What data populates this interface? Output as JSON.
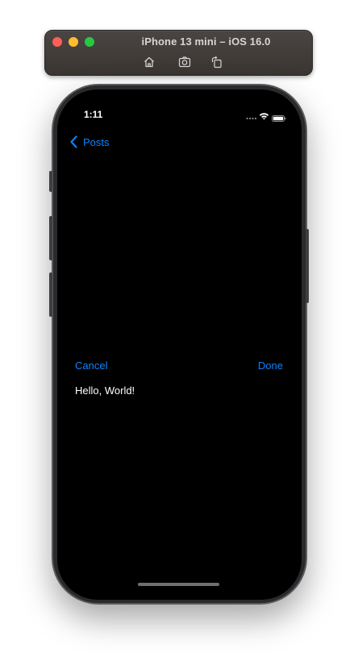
{
  "simulator": {
    "title": "iPhone 13 mini – iOS 16.0",
    "toolbar": [
      {
        "icon": "home-icon"
      },
      {
        "icon": "screenshot-icon"
      },
      {
        "icon": "rotate-icon"
      }
    ]
  },
  "status_bar": {
    "time": "1:11",
    "icons": [
      "signal-dots-icon",
      "wifi-icon",
      "battery-icon"
    ]
  },
  "nav": {
    "back_label": "Posts",
    "back_icon": "chevron-left-icon"
  },
  "editor": {
    "cancel_label": "Cancel",
    "done_label": "Done",
    "text": "Hello, World!"
  },
  "colors": {
    "accent": "#0a84ff",
    "screen_background": "#000000",
    "text": "#ffffff"
  }
}
